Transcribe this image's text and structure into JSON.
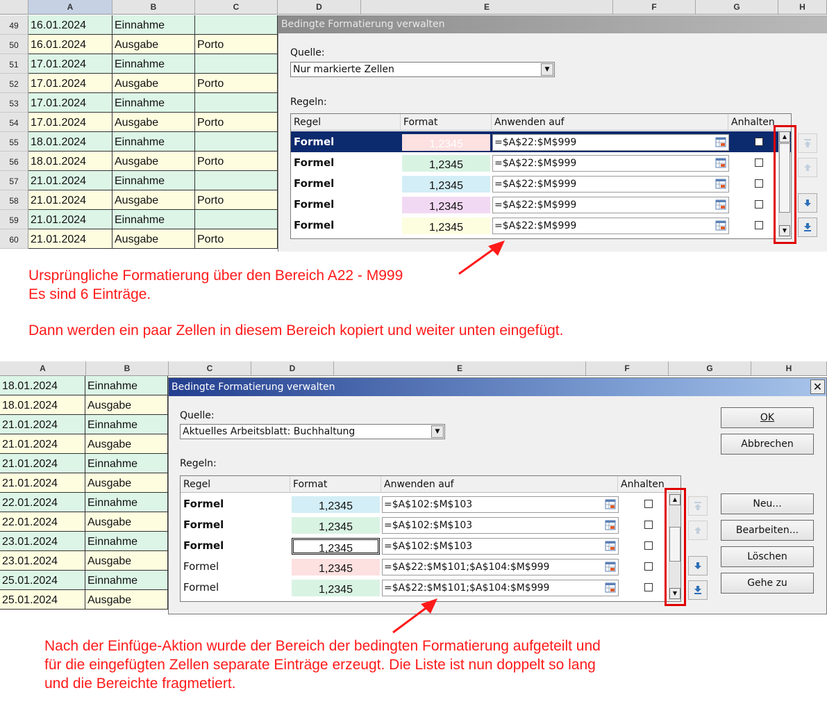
{
  "sheet1": {
    "columns": [
      "A",
      "B",
      "C",
      "D",
      "E",
      "F",
      "G",
      "H"
    ],
    "rows": [
      {
        "num": "49",
        "date": "16.01.2024",
        "type": "Einnahme",
        "note": "",
        "color": "green"
      },
      {
        "num": "50",
        "date": "16.01.2024",
        "type": "Ausgabe",
        "note": "Porto",
        "color": "yellow"
      },
      {
        "num": "51",
        "date": "17.01.2024",
        "type": "Einnahme",
        "note": "",
        "color": "green"
      },
      {
        "num": "52",
        "date": "17.01.2024",
        "type": "Ausgabe",
        "note": "Porto",
        "color": "yellow"
      },
      {
        "num": "53",
        "date": "17.01.2024",
        "type": "Einnahme",
        "note": "",
        "color": "green"
      },
      {
        "num": "54",
        "date": "17.01.2024",
        "type": "Ausgabe",
        "note": "Porto",
        "color": "yellow"
      },
      {
        "num": "55",
        "date": "18.01.2024",
        "type": "Einnahme",
        "note": "",
        "color": "green"
      },
      {
        "num": "56",
        "date": "18.01.2024",
        "type": "Ausgabe",
        "note": "Porto",
        "color": "yellow"
      },
      {
        "num": "57",
        "date": "21.01.2024",
        "type": "Einnahme",
        "note": "",
        "color": "green"
      },
      {
        "num": "58",
        "date": "21.01.2024",
        "type": "Ausgabe",
        "note": "Porto",
        "color": "yellow"
      },
      {
        "num": "59",
        "date": "21.01.2024",
        "type": "Einnahme",
        "note": "",
        "color": "green"
      },
      {
        "num": "60",
        "date": "21.01.2024",
        "type": "Ausgabe",
        "note": "Porto",
        "color": "yellow"
      }
    ]
  },
  "dialog1": {
    "title": "Bedingte Formatierung verwalten",
    "source_label": "Quelle:",
    "source_value": "Nur markierte Zellen",
    "rules_label": "Regeln:",
    "headers": [
      "Regel",
      "Format",
      "Anwenden auf",
      "Anhalten"
    ],
    "rules": [
      {
        "name": "Formel",
        "sample": "1,2345",
        "color": "pink",
        "range": "=$A$22:$M$999",
        "selected": true
      },
      {
        "name": "Formel",
        "sample": "1,2345",
        "color": "mint",
        "range": "=$A$22:$M$999",
        "selected": false
      },
      {
        "name": "Formel",
        "sample": "1,2345",
        "color": "cyan",
        "range": "=$A$22:$M$999",
        "selected": false
      },
      {
        "name": "Formel",
        "sample": "1,2345",
        "color": "lilac",
        "range": "=$A$22:$M$999",
        "selected": false
      },
      {
        "name": "Formel",
        "sample": "1,2345",
        "color": "cream",
        "range": "=$A$22:$M$999",
        "selected": false
      }
    ]
  },
  "annotation1": {
    "line1": "Ursprüngliche Formatierung über den Bereich A22 - M999",
    "line2": "Es sind 6 Einträge.",
    "line3": "Dann werden ein paar Zellen in diesem Bereich kopiert und weiter unten eingefügt."
  },
  "sheet2": {
    "columns": [
      "A",
      "B",
      "C",
      "D",
      "E",
      "F",
      "G",
      "H"
    ],
    "rows": [
      {
        "date": "18.01.2024",
        "type": "Einnahme",
        "color": "green"
      },
      {
        "date": "18.01.2024",
        "type": "Ausgabe",
        "color": "yellow"
      },
      {
        "date": "21.01.2024",
        "type": "Einnahme",
        "color": "green"
      },
      {
        "date": "21.01.2024",
        "type": "Ausgabe",
        "color": "yellow"
      },
      {
        "date": "21.01.2024",
        "type": "Einnahme",
        "color": "green"
      },
      {
        "date": "21.01.2024",
        "type": "Ausgabe",
        "color": "yellow"
      },
      {
        "date": "22.01.2024",
        "type": "Einnahme",
        "color": "green"
      },
      {
        "date": "22.01.2024",
        "type": "Ausgabe",
        "color": "yellow"
      },
      {
        "date": "23.01.2024",
        "type": "Einnahme",
        "color": "green"
      },
      {
        "date": "23.01.2024",
        "type": "Ausgabe",
        "color": "yellow"
      },
      {
        "date": "25.01.2024",
        "type": "Einnahme",
        "color": "green"
      },
      {
        "date": "25.01.2024",
        "type": "Ausgabe",
        "color": "yellow"
      }
    ]
  },
  "dialog2": {
    "title": "Bedingte Formatierung verwalten",
    "source_label": "Quelle:",
    "source_value": "Aktuelles Arbeitsblatt: Buchhaltung",
    "rules_label": "Regeln:",
    "headers": [
      "Regel",
      "Format",
      "Anwenden auf",
      "Anhalten"
    ],
    "rules": [
      {
        "name": "Formel",
        "bold": true,
        "sample": "1,2345",
        "color": "cyan",
        "range": "=$A$102:$M$103"
      },
      {
        "name": "Formel",
        "bold": true,
        "sample": "1,2345",
        "color": "mint",
        "range": "=$A$102:$M$103"
      },
      {
        "name": "Formel",
        "bold": true,
        "sample": "1,2345",
        "color": "white",
        "range": "=$A$102:$M$103"
      },
      {
        "name": "Formel",
        "bold": false,
        "sample": "1,2345",
        "color": "pink",
        "range": "=$A$22:$M$101;$A$104:$M$999"
      },
      {
        "name": "Formel",
        "bold": false,
        "sample": "1,2345",
        "color": "mint",
        "range": "=$A$22:$M$101;$A$104:$M$999"
      }
    ],
    "buttons": {
      "ok": "OK",
      "cancel": "Abbrechen",
      "new": "Neu...",
      "edit": "Bearbeiten...",
      "delete": "Löschen",
      "goto": "Gehe zu"
    }
  },
  "annotation2": {
    "line1": "Nach der Einfüge-Aktion wurde der Bereich der bedingten Formatierung aufgeteilt und",
    "line2": "für die eingefügten Zellen separate Einträge erzeugt. Die Liste ist nun doppelt so lang",
    "line3": "und die Bereichte fragmetiert."
  },
  "colors": {
    "annotation_red": "#ff1a1a",
    "selection_blue": "#0c2a6e",
    "title_active": "#233f8f"
  }
}
